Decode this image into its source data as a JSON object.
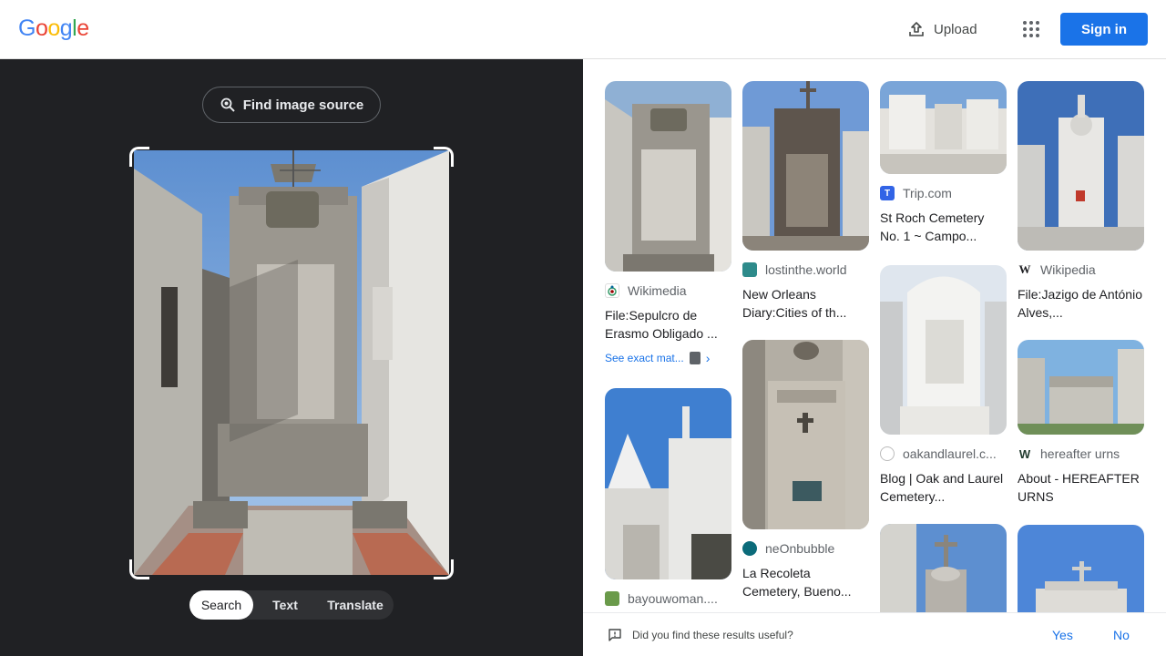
{
  "header": {
    "logo_letters": [
      "G",
      "o",
      "o",
      "g",
      "l",
      "e"
    ],
    "logo_colors": [
      "#4285F4",
      "#EA4335",
      "#FBBC05",
      "#4285F4",
      "#34A853",
      "#EA4335"
    ],
    "upload_label": "Upload",
    "signin_label": "Sign in"
  },
  "left": {
    "find_source_label": "Find image source",
    "tabs": [
      "Search",
      "Text",
      "Translate"
    ],
    "active_tab": "Search"
  },
  "results": [
    {
      "source": "Wikimedia",
      "title": "File:Sepulcro de Erasmo Obligado ...",
      "exact": "See exact mat..."
    },
    {
      "source": "bayouwoman...."
    },
    {
      "source": "lostinthe.world",
      "title": "New Orleans Diary:Cities of th..."
    },
    {
      "source": "neOnbubble",
      "title": "La Recoleta Cemetery, Bueno..."
    },
    {
      "source": "Trip.com",
      "title": "St Roch Cemetery No. 1 ~ Campo..."
    },
    {
      "source": "oakandlaurel.c...",
      "title": "Blog | Oak and Laurel Cemetery..."
    },
    {
      "source": "Wikipedia",
      "title": "File:Jazigo de António Alves,..."
    },
    {
      "source": "hereafter urns",
      "title": "About - HEREAFTER URNS"
    }
  ],
  "feedback": {
    "question": "Did you find these results useful?",
    "yes": "Yes",
    "no": "No"
  },
  "colors": {
    "accent": "#1a73e8",
    "left_bg": "#202124"
  }
}
